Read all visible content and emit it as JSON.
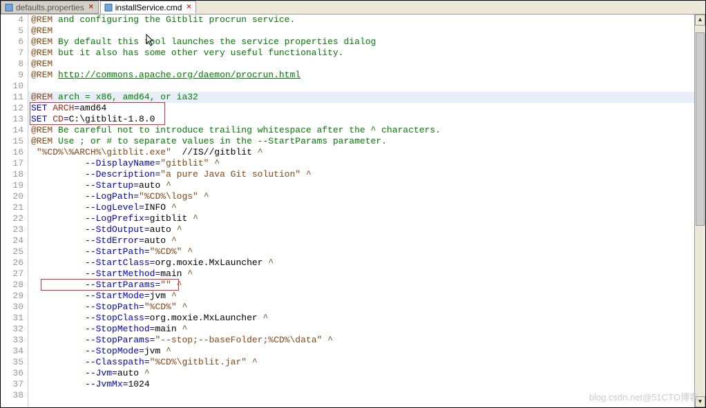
{
  "tabs": [
    {
      "label": "defaults.properties",
      "active": false
    },
    {
      "label": "installService.cmd",
      "active": true
    }
  ],
  "gutter_start": 4,
  "gutter_end": 38,
  "code": {
    "l4": {
      "rem": "@REM",
      "txt": " and configuring the Gitblit procrun service."
    },
    "l5": {
      "rem": "@REM"
    },
    "l6": {
      "rem": "@REM",
      "txt": " By default this tool launches the service properties dialog"
    },
    "l7": {
      "rem": "@REM",
      "txt": " but it also has some other very useful functionality."
    },
    "l8": {
      "rem": "@REM"
    },
    "l9": {
      "rem": "@REM",
      "link": "http://commons.apache.org/daemon/procrun.html"
    },
    "l10": {
      "blank": ""
    },
    "l11": {
      "rem": "@REM",
      "txt": " arch = x86, amd64, or ia32"
    },
    "l12": {
      "set": "SET",
      "var": " ARCH",
      "eq": "=",
      "val": "amd64"
    },
    "l13": {
      "set": "SET",
      "var": " CD",
      "eq": "=",
      "val": "C:\\gitblit-1.8.0"
    },
    "l14": {
      "rem": "@REM",
      "txt": " Be careful not to introduce trailing whitespace after the ^ characters."
    },
    "l15": {
      "rem": "@REM",
      "txt": " Use ; or # to separate values in the --StartParams parameter."
    },
    "l16": {
      "pre": " ",
      "q1": "\"%CD%\\%ARCH%\\gitblit.exe\"",
      "mid": "  //IS//gitblit ",
      "caret": "^"
    },
    "l17": {
      "pad": "          ",
      "opt": "--DisplayName",
      "eq": "=",
      "val": "\"gitblit\"",
      "sp": " ",
      "caret": "^"
    },
    "l18": {
      "pad": "          ",
      "opt": "--Description",
      "eq": "=",
      "val": "\"a pure Java Git solution\"",
      "sp": " ",
      "caret": "^"
    },
    "l19": {
      "pad": "          ",
      "opt": "--Startup",
      "eq": "=",
      "val": "auto",
      "sp": " ",
      "caret": "^"
    },
    "l20": {
      "pad": "          ",
      "opt": "--LogPath",
      "eq": "=",
      "val": "\"%CD%\\logs\"",
      "sp": " ",
      "caret": "^"
    },
    "l21": {
      "pad": "          ",
      "opt": "--LogLevel",
      "eq": "=",
      "val": "INFO",
      "sp": " ",
      "caret": "^"
    },
    "l22": {
      "pad": "          ",
      "opt": "--LogPrefix",
      "eq": "=",
      "val": "gitblit",
      "sp": " ",
      "caret": "^"
    },
    "l23": {
      "pad": "          ",
      "opt": "--StdOutput",
      "eq": "=",
      "val": "auto",
      "sp": " ",
      "caret": "^"
    },
    "l24": {
      "pad": "          ",
      "opt": "--StdError",
      "eq": "=",
      "val": "auto",
      "sp": " ",
      "caret": "^"
    },
    "l25": {
      "pad": "          ",
      "opt": "--StartPath",
      "eq": "=",
      "val": "\"%CD%\"",
      "sp": " ",
      "caret": "^"
    },
    "l26": {
      "pad": "          ",
      "opt": "--StartClass",
      "eq": "=",
      "val": "org.moxie.MxLauncher",
      "sp": " ",
      "caret": "^"
    },
    "l27": {
      "pad": "          ",
      "opt": "--StartMethod",
      "eq": "=",
      "val": "main",
      "sp": " ",
      "caret": "^"
    },
    "l28": {
      "pad": "          ",
      "opt": "--StartParams",
      "eq": "=",
      "val": "\"\"",
      "sp": " ",
      "caret": "^"
    },
    "l29": {
      "pad": "          ",
      "opt": "--StartMode",
      "eq": "=",
      "val": "jvm",
      "sp": " ",
      "caret": "^"
    },
    "l30": {
      "pad": "          ",
      "opt": "--StopPath",
      "eq": "=",
      "val": "\"%CD%\"",
      "sp": " ",
      "caret": "^"
    },
    "l31": {
      "pad": "          ",
      "opt": "--StopClass",
      "eq": "=",
      "val": "org.moxie.MxLauncher",
      "sp": " ",
      "caret": "^"
    },
    "l32": {
      "pad": "          ",
      "opt": "--StopMethod",
      "eq": "=",
      "val": "main",
      "sp": " ",
      "caret": "^"
    },
    "l33": {
      "pad": "          ",
      "opt": "--StopParams",
      "eq": "=",
      "val": "\"--stop;--baseFolder;%CD%\\data\"",
      "sp": " ",
      "caret": "^"
    },
    "l34": {
      "pad": "          ",
      "opt": "--StopMode",
      "eq": "=",
      "val": "jvm",
      "sp": " ",
      "caret": "^"
    },
    "l35": {
      "pad": "          ",
      "opt": "--Classpath",
      "eq": "=",
      "val": "\"%CD%\\gitblit.jar\"",
      "sp": " ",
      "caret": "^"
    },
    "l36": {
      "pad": "          ",
      "opt": "--Jvm",
      "eq": "=",
      "val": "auto",
      "sp": " ",
      "caret": "^"
    },
    "l37": {
      "pad": "          ",
      "opt": "--JvmMx",
      "eq": "=",
      "val": "1024"
    },
    "l38": {
      "blank": ""
    }
  },
  "watermark": "blog.csdn.net@51CTO博客"
}
